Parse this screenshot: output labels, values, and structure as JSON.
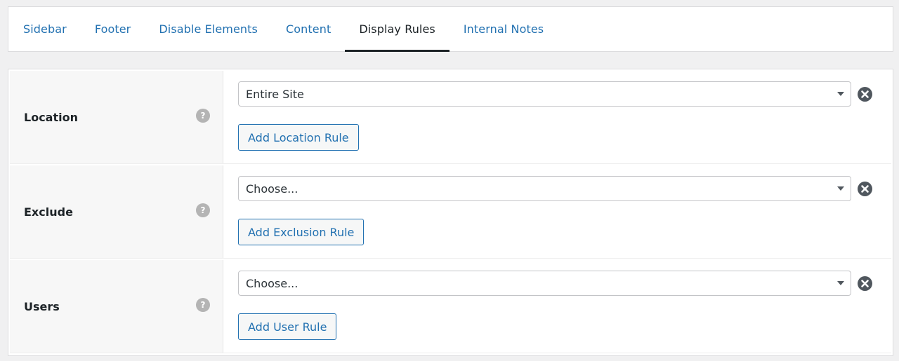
{
  "tabs": [
    {
      "label": "Sidebar",
      "active": false
    },
    {
      "label": "Footer",
      "active": false
    },
    {
      "label": "Disable Elements",
      "active": false
    },
    {
      "label": "Content",
      "active": false
    },
    {
      "label": "Display Rules",
      "active": true
    },
    {
      "label": "Internal Notes",
      "active": false
    }
  ],
  "rules": [
    {
      "label": "Location",
      "help": "?",
      "select_value": "Entire Site",
      "button_label": "Add Location Rule"
    },
    {
      "label": "Exclude",
      "help": "?",
      "select_value": "Choose...",
      "button_label": "Add Exclusion Rule"
    },
    {
      "label": "Users",
      "help": "?",
      "select_value": "Choose...",
      "button_label": "Add User Rule"
    }
  ],
  "icons": {
    "help": "question-mark-icon",
    "remove": "close-circle-icon",
    "dropdown": "chevron-down-icon"
  },
  "colors": {
    "link": "#2271b1",
    "text": "#1d2327",
    "background": "#f0f0f1"
  }
}
